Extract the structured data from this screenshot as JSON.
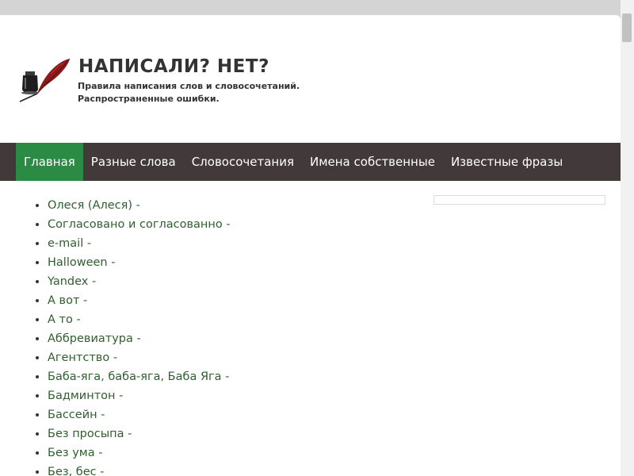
{
  "header": {
    "site_title": "НАПИСАЛИ? НЕТ?",
    "description_line1": "Правила написания слов и словосочетаний.",
    "description_line2": "Распространенные ошибки."
  },
  "nav": {
    "items": [
      {
        "label": "Главная",
        "active": true
      },
      {
        "label": "Разные слова",
        "active": false
      },
      {
        "label": "Словосочетания",
        "active": false
      },
      {
        "label": "Имена собственные",
        "active": false
      },
      {
        "label": "Известные фразы",
        "active": false
      }
    ]
  },
  "articles": [
    "Олеся (Алеся) -",
    "Согласовано и согласованно -",
    "e-mail -",
    "Halloween -",
    "Yandex -",
    "А вот -",
    "А то -",
    "Аббревиатура -",
    "Агентство -",
    "Баба-яга, баба-яга, Баба Яга -",
    "Бадминтон -",
    "Бассейн -",
    "Без просыпа -",
    "Без ума -",
    "Без, бес -"
  ],
  "colors": {
    "nav_background": "#423a3a",
    "nav_active": "#2b8a43",
    "link_color": "#2f5e2f"
  },
  "icons": {
    "logo": "inkwell-quill-icon"
  }
}
